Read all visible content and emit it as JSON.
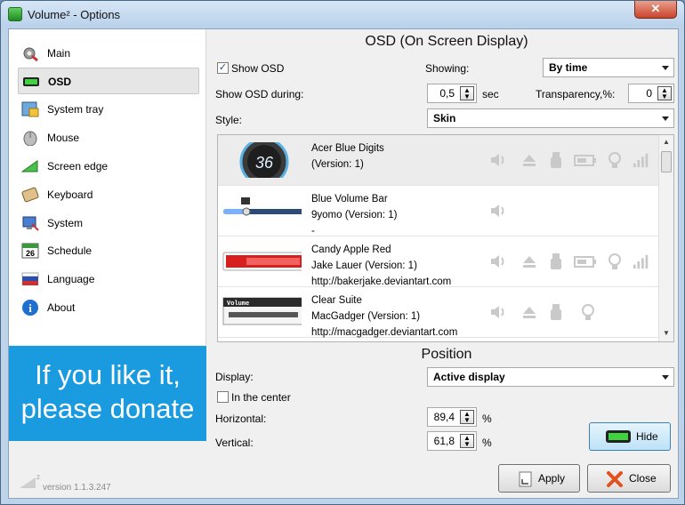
{
  "window": {
    "title": "Volume² - Options",
    "close_glyph": "✕"
  },
  "sidebar": {
    "items": [
      {
        "label": "Main",
        "icon": "gear-icon"
      },
      {
        "label": "OSD",
        "icon": "osd-bar-icon"
      },
      {
        "label": "System tray",
        "icon": "tray-icon"
      },
      {
        "label": "Mouse",
        "icon": "mouse-icon"
      },
      {
        "label": "Screen edge",
        "icon": "screen-edge-icon"
      },
      {
        "label": "Keyboard",
        "icon": "keyboard-icon"
      },
      {
        "label": "System",
        "icon": "system-icon"
      },
      {
        "label": "Schedule",
        "icon": "calendar-icon",
        "badge": "26"
      },
      {
        "label": "Language",
        "icon": "flag-icon"
      },
      {
        "label": "About",
        "icon": "info-icon"
      }
    ],
    "donate_text": "If you like it, please donate",
    "version": "version 1.1.3.247",
    "logo_sup": "2"
  },
  "osd": {
    "heading": "OSD (On Screen Display)",
    "show_osd_label": "Show OSD",
    "show_osd_checked": true,
    "showing_label": "Showing:",
    "showing_value": "By time",
    "show_during_label": "Show OSD during:",
    "show_during_value": "0,5",
    "sec_label": "sec",
    "transparency_label": "Transparency,%:",
    "transparency_value": "0",
    "style_label": "Style:",
    "style_value": "Skin",
    "skins": [
      {
        "name": "Acer Blue Digits",
        "author": "(Version: 1)",
        "url": "",
        "thumb_text": "36"
      },
      {
        "name": "Blue Volume Bar",
        "author": "9yomo (Version: 1)",
        "url": "-",
        "thumb_text": ""
      },
      {
        "name": "Candy Apple Red",
        "author": "Jake Lauer (Version: 1)",
        "url": "http://bakerjake.deviantart.com",
        "thumb_text": ""
      },
      {
        "name": "Clear Suite",
        "author": "MacGadger (Version: 1)",
        "url": "http://macgadger.deviantart.com",
        "thumb_text": "Volume"
      }
    ]
  },
  "position": {
    "heading": "Position",
    "display_label": "Display:",
    "display_value": "Active display",
    "center_label": "In the center",
    "center_checked": false,
    "horizontal_label": "Horizontal:",
    "horizontal_value": "89,4",
    "vertical_label": "Vertical:",
    "vertical_value": "61,8",
    "percent": "%"
  },
  "buttons": {
    "hide": "Hide",
    "apply": "Apply",
    "close": "Close"
  },
  "colors": {
    "accent": "#1a9be0",
    "titlebar": "#bcd3ea",
    "close": "#c9442b"
  }
}
